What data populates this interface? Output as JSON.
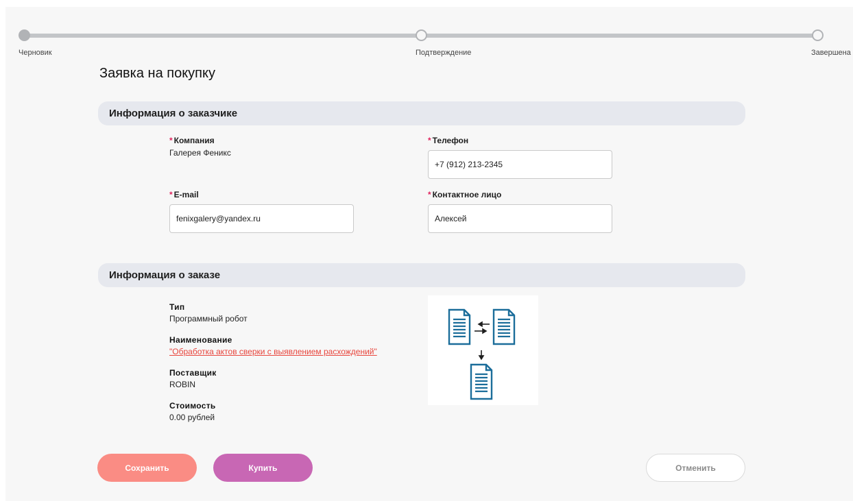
{
  "stepper": {
    "steps": [
      {
        "label": "Черновик",
        "state": "done"
      },
      {
        "label": "Подтверждение",
        "state": "pending"
      },
      {
        "label": "Завершена",
        "state": "pending"
      }
    ]
  },
  "title": "Заявка на покупку",
  "customer": {
    "header": "Информация о заказчике",
    "company": {
      "label": "Компания",
      "value": "Галерея Феникс"
    },
    "phone": {
      "label": "Телефон",
      "value": "+7 (912) 213-2345"
    },
    "email": {
      "label": "E-mail",
      "value": "fenixgalery@yandex.ru"
    },
    "contact": {
      "label": "Контактное лицо",
      "value": "Алексей"
    },
    "required_mark": "*"
  },
  "order": {
    "header": "Информация о заказе",
    "type": {
      "label": "Тип",
      "value": "Программный робот"
    },
    "name": {
      "label": "Наименование",
      "value": "\"Обработка актов сверки с выявлением расхождений\""
    },
    "vendor": {
      "label": "Поставщик",
      "value": "ROBIN"
    },
    "cost": {
      "label": "Стоимость",
      "value": "0.00 рублей"
    },
    "image_icon": "documents-compare-icon"
  },
  "buttons": {
    "save": "Сохранить",
    "buy": "Купить",
    "cancel": "Отменить"
  },
  "colors": {
    "accent_save": "#fa8c84",
    "accent_buy": "#c867b4",
    "required": "#e0245e",
    "link": "#e8453c",
    "doc_icon": "#1b6d9a"
  }
}
